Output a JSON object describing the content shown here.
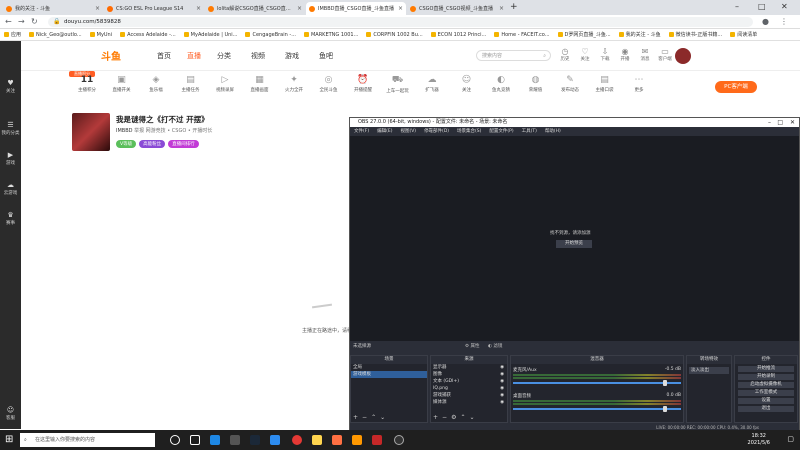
{
  "browser": {
    "tabs": [
      {
        "title": "我的关注 - 斗鱼",
        "color": "#ff7a00",
        "active": false
      },
      {
        "title": "CS:GO ESL Pro League S14",
        "color": "#ff6a00",
        "active": false
      },
      {
        "title": "lolita解说CSGO直播_CSGO直播...",
        "color": "#ff7a00",
        "active": false
      },
      {
        "title": "IMBBD直播_CSGO直播_斗鱼直播",
        "color": "#ff7a00",
        "active": true
      },
      {
        "title": "CSGO直播_CSGO视频_斗鱼直播",
        "color": "#ff7a00",
        "active": false
      }
    ],
    "new_tab": "+",
    "url": "douyu.com/5839828",
    "bookmarks": [
      "应用",
      "Nick_Geo@outlo...",
      "MyUni",
      "Access Adelaide -...",
      "MyAdelaide | Uni...",
      "CengageBrain -...",
      "MARKETNG 1001...",
      "CORPFIN 1002 Bu...",
      "ECON 1012 Princi...",
      "Home - FACEIT.co...",
      "D罗网页直播_斗鱼...",
      "我的关注 - 斗鱼",
      "微信读书-正版书籍...",
      "阅读清单"
    ]
  },
  "douyu": {
    "logo": "斗鱼",
    "nav": [
      "首页",
      "直播",
      "分类",
      "视频",
      "游戏",
      "鱼吧"
    ],
    "search_placeholder": "搜索内容",
    "header_icons": [
      "历史",
      "关注",
      "下载",
      "开播",
      "消息",
      "客户端"
    ],
    "left_nav": [
      "关注",
      "我的分类",
      "游戏",
      "云游戏",
      "赛事",
      "客服"
    ],
    "categories": [
      {
        "label": "主播积分",
        "top": "11"
      },
      {
        "label": "直播开关",
        "top": ""
      },
      {
        "label": "鱼乐福",
        "top": ""
      },
      {
        "label": "主播任务",
        "top": ""
      },
      {
        "label": "视频录屏",
        "top": ""
      },
      {
        "label": "直播画面",
        "top": ""
      },
      {
        "label": "火力全开",
        "top": ""
      },
      {
        "label": "全民斗鱼",
        "top": ""
      },
      {
        "label": "开播提醒",
        "top": ""
      },
      {
        "label": "上车一起玩",
        "top": ""
      },
      {
        "label": "扩飞器",
        "top": ""
      },
      {
        "label": "关注",
        "top": ""
      },
      {
        "label": "鱼丸竞猜",
        "top": ""
      },
      {
        "label": "荣耀值",
        "top": ""
      },
      {
        "label": "发布动态",
        "top": ""
      },
      {
        "label": "主播口袋",
        "top": ""
      },
      {
        "label": "更多",
        "top": ""
      }
    ],
    "pc_client_button": "PC客户端",
    "streamer": {
      "title": "我是谜得之《打不过 开摆》",
      "meta": "举报   网游竞技 • CSGO • 开播时长",
      "name": "IMBBD",
      "room_badges": [
        "V等级",
        "高能粉丝",
        "直播间排行"
      ]
    },
    "video_caption": "主播正在路途中，请稍等..."
  },
  "obs": {
    "title": "OBS 27.0.0 (64-bit, windows) - 配置文件: 未命名 - 场景: 未命名",
    "menu": [
      "文件(F)",
      "编辑(E)",
      "视图(V)",
      "停靠部件(D)",
      "场景集合(S)",
      "配置文件(P)",
      "工具(T)",
      "帮助(H)"
    ],
    "preview_message": "找不到源，请添加源",
    "preview_button": "开始预览",
    "source_bar": "未选择源",
    "scenes_title": "场景",
    "scenes": [
      "全局",
      "游戏模板"
    ],
    "sources_title": "来源",
    "sources": [
      "显示器",
      "图像",
      "文本 (GDI+)",
      "IQ.png",
      "游戏捕获",
      "媒体源"
    ],
    "mixer_title": "混音器",
    "mixer": [
      {
        "name": "麦克风/Aux",
        "level": "-0.5 dB"
      },
      {
        "name": "桌面音频",
        "level": "0.0 dB"
      }
    ],
    "transitions_title": "转场特效",
    "transition_value": "淡入淡出",
    "controls_title": "控件",
    "controls": [
      "开始推流",
      "开始录制",
      "启动虚拟摄像机",
      "工作室模式",
      "设置",
      "退出"
    ],
    "status": "LIVE: 00:00:00   REC: 00:00:00   CPU: 0.4%, 30.00 fps"
  },
  "taskbar": {
    "search_placeholder": "在这里输入你要搜索的内容",
    "time": "18:32",
    "date": "2021/5/6"
  }
}
